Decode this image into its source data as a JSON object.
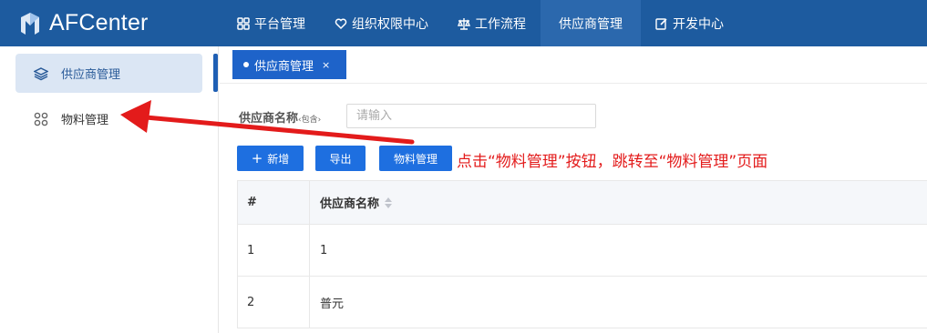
{
  "app": {
    "title": "AFCenter"
  },
  "nav": {
    "items": [
      {
        "label": "平台管理",
        "icon": "grid-icon"
      },
      {
        "label": "组织权限中心",
        "icon": "heart-shield-icon"
      },
      {
        "label": "工作流程",
        "icon": "scale-icon"
      },
      {
        "label": "供应商管理",
        "icon": "",
        "active": true
      },
      {
        "label": "开发中心",
        "icon": "edit-icon"
      }
    ]
  },
  "sidebar": {
    "items": [
      {
        "label": "供应商管理",
        "icon": "layers-icon",
        "active": true
      },
      {
        "label": "物料管理",
        "icon": "grid-circles-icon",
        "active": false
      }
    ]
  },
  "tabs": [
    {
      "label": "供应商管理",
      "close": "×"
    }
  ],
  "search": {
    "label": "供应商名称",
    "hint": "‹包含›",
    "placeholder": "请输入"
  },
  "toolbar": {
    "add_label": "新增",
    "add_icon": "+",
    "export_label": "导出",
    "material_label": "物料管理"
  },
  "annotation": "点击“物料管理”按钮，跳转至“物料管理”页面",
  "table": {
    "columns": [
      "#",
      "供应商名称"
    ],
    "rows": [
      [
        "1",
        "1"
      ],
      [
        "2",
        "普元"
      ]
    ]
  },
  "colors": {
    "topbar": "#1d5b9f",
    "accent": "#1e6fe0",
    "annotation": "#e31b1b"
  }
}
